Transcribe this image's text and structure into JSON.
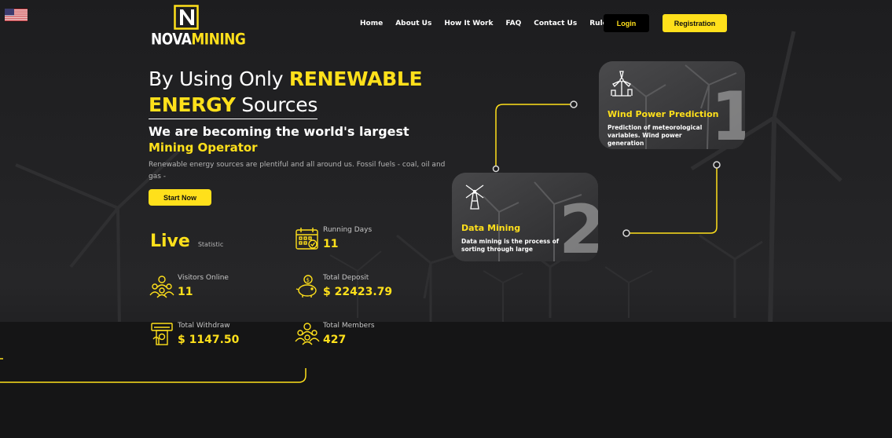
{
  "brand": {
    "logo_white": "NOVA",
    "logo_yellow": "MINING",
    "accent": "#ffe01b",
    "background": "#1c1c1e"
  },
  "language": {
    "icon": "us-flag-icon"
  },
  "nav": {
    "items": [
      "Home",
      "About Us",
      "How It Work",
      "FAQ",
      "Contact Us",
      "Rules"
    ],
    "login_label": "Login",
    "register_label": "Registration"
  },
  "hero": {
    "title_part1": "By Using Only ",
    "title_highlight1": "RENEWABLE",
    "title_highlight2": "ENERGY",
    "title_part2": " Sources",
    "subtitle": "We are becoming the world's largest",
    "subtitle_highlight": "Mining Operator",
    "description": "Renewable energy sources are plentiful and all around us. Fossil fuels - coal, oil and gas -",
    "cta_label": "Start Now"
  },
  "stats": {
    "live_label": "Live",
    "live_sub": "Statistic",
    "running_days": {
      "label": "Running Days",
      "value": "11",
      "icon": "calendar-icon"
    },
    "visitors_online": {
      "label": "Visitors Online",
      "value": "11",
      "icon": "users-icon"
    },
    "total_deposit": {
      "label": "Total Deposit",
      "value": "$ 22423.79",
      "icon": "piggy-bank-icon"
    },
    "total_withdraw": {
      "label": "Total Withdraw",
      "value": "$ 1147.50",
      "icon": "atm-withdraw-icon"
    },
    "total_members": {
      "label": "Total Members",
      "value": "427",
      "icon": "members-icon"
    }
  },
  "cards": [
    {
      "number": "1",
      "title": "Wind Power Prediction",
      "text": "Prediction of meteorological variables. Wind power generation",
      "icon": "wind-turbine-icon"
    },
    {
      "number": "2",
      "title": "Data Mining",
      "text": "Data mining is the process of sorting through large",
      "icon": "windmill-icon"
    }
  ]
}
